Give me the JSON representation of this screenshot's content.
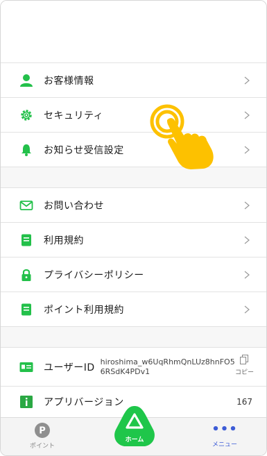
{
  "menu": {
    "group1": [
      {
        "label": "お客様情報",
        "icon": "person-icon"
      },
      {
        "label": "セキュリティ",
        "icon": "gear-icon"
      },
      {
        "label": "お知らせ受信設定",
        "icon": "bell-icon"
      }
    ],
    "group2": [
      {
        "label": "お問い合わせ",
        "icon": "mail-icon"
      },
      {
        "label": "利用規約",
        "icon": "document-icon"
      },
      {
        "label": "プライバシーポリシー",
        "icon": "lock-icon"
      },
      {
        "label": "ポイント利用規約",
        "icon": "document-icon"
      }
    ],
    "user_id": {
      "label": "ユーザーID",
      "value_line1": "hiroshima_w6UqRhmQnLUz8hnFO5",
      "value_line2": "6RSdK4PDv1",
      "copy_label": "コピー",
      "icon": "id-card-icon"
    },
    "app_version": {
      "label": "アプリバージョン",
      "value": "167",
      "icon": "info-icon"
    }
  },
  "tabbar": {
    "points_label": "ポイント",
    "points_glyph": "P",
    "home_label": "ホーム",
    "menu_label": "メニュー",
    "menu_glyph": "•••"
  },
  "colors": {
    "accent": "#1fc64a",
    "icon_green": "#23c04a",
    "lock_orange": "#f5a400",
    "tap_yellow": "#fdc100",
    "info_green": "#2aa843",
    "tab_blue": "#3c5bd6"
  }
}
